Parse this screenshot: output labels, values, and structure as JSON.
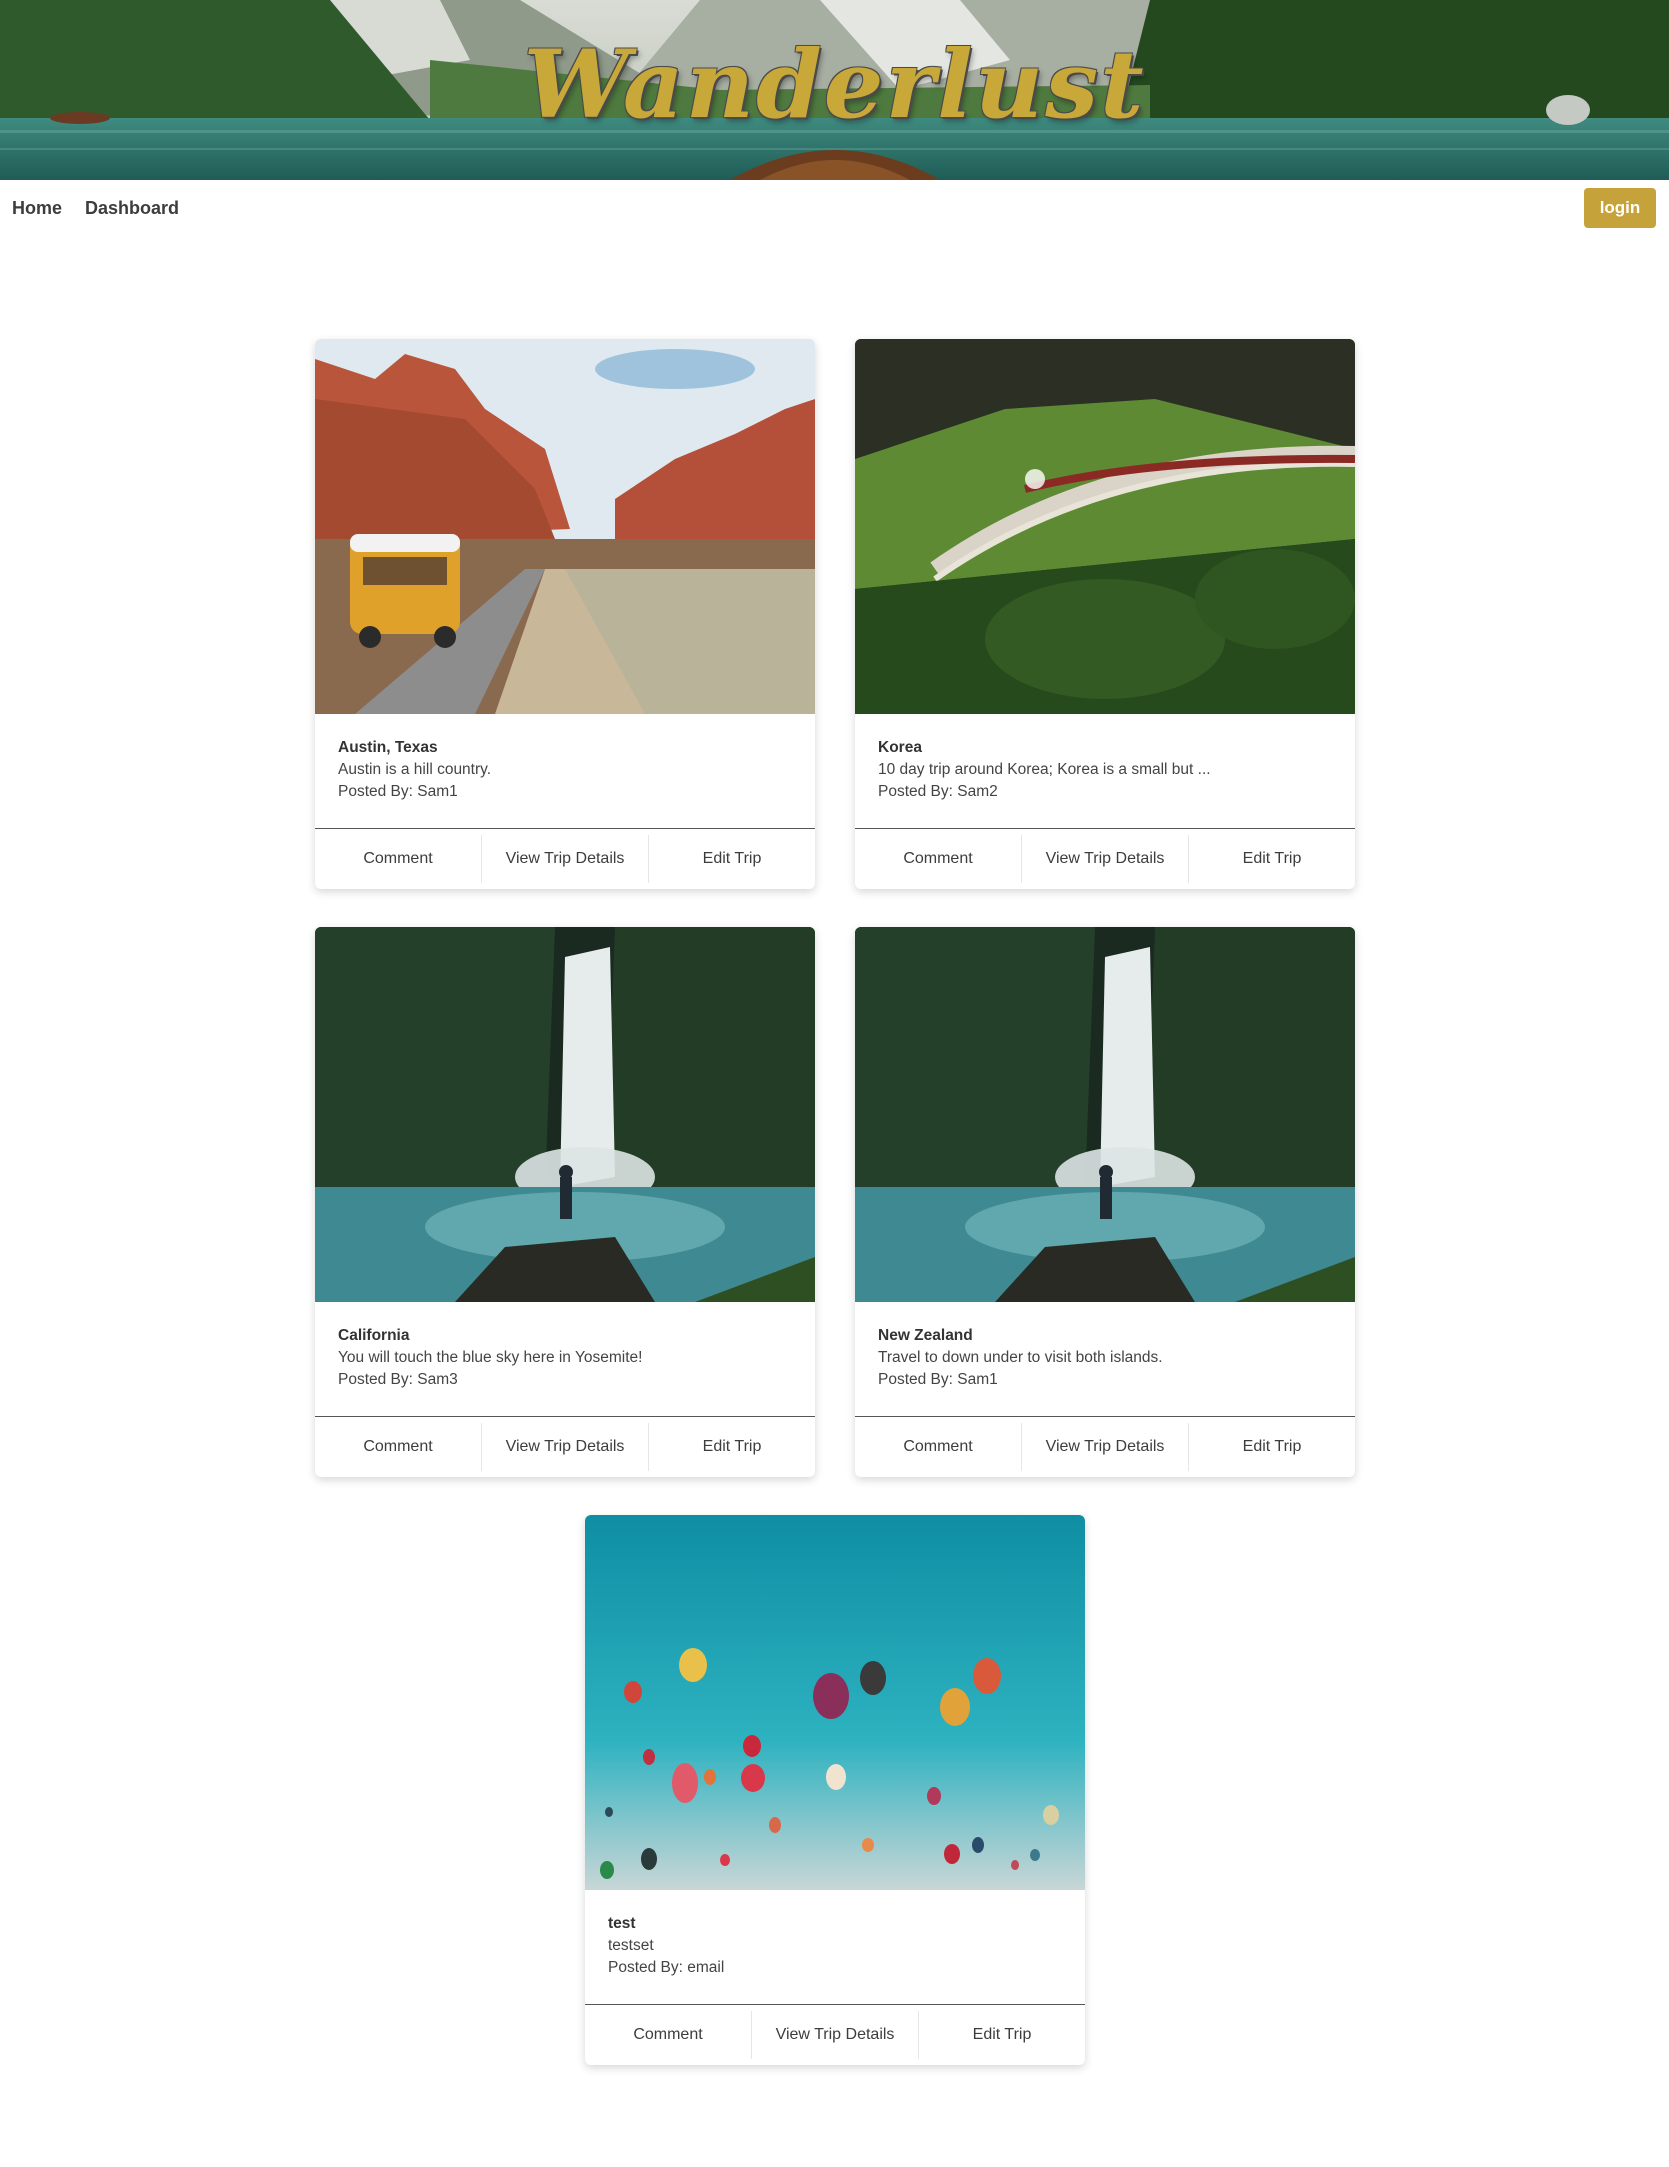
{
  "brand": {
    "title": "Wanderlust"
  },
  "nav": {
    "home": "Home",
    "dashboard": "Dashboard",
    "login": "login"
  },
  "colors": {
    "accent": "#c6a23a"
  },
  "trips": [
    {
      "title": "Austin, Texas",
      "description": "Austin is a hill country.",
      "posted_by": "Posted By: Sam1",
      "image": "desert-road-van",
      "comment": "Comment",
      "view": "View Trip Details",
      "edit": "Edit Trip"
    },
    {
      "title": "Korea",
      "description": "10 day trip around Korea; Korea is a small but ...",
      "posted_by": "Posted By: Sam2",
      "image": "viaduct-train",
      "comment": "Comment",
      "view": "View Trip Details",
      "edit": "Edit Trip"
    },
    {
      "title": "California",
      "description": "You will touch the blue sky here in Yosemite!",
      "posted_by": "Posted By: Sam3",
      "image": "waterfall",
      "comment": "Comment",
      "view": "View Trip Details",
      "edit": "Edit Trip"
    },
    {
      "title": "New Zealand",
      "description": "Travel to down under to visit both islands.",
      "posted_by": "Posted By: Sam1",
      "image": "waterfall",
      "comment": "Comment",
      "view": "View Trip Details",
      "edit": "Edit Trip"
    },
    {
      "title": "test",
      "description": "testset",
      "posted_by": "Posted By: email",
      "image": "hot-air-balloons",
      "comment": "Comment",
      "view": "View Trip Details",
      "edit": "Edit Trip"
    }
  ]
}
